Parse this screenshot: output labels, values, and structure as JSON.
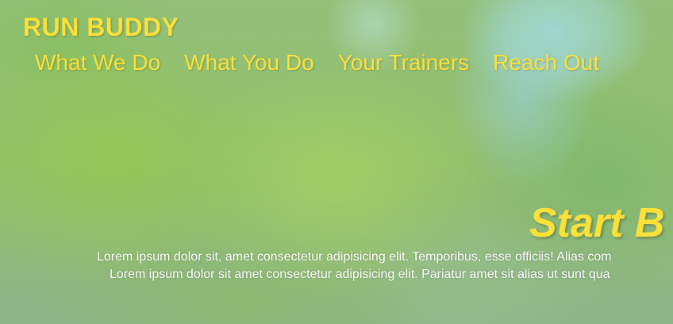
{
  "header": {
    "logo": "RUN BUDDY",
    "nav": [
      {
        "label": "What We Do"
      },
      {
        "label": "What You Do"
      },
      {
        "label": "Your Trainers"
      },
      {
        "label": "Reach Out"
      }
    ]
  },
  "hero": {
    "title": "Start B",
    "lines": [
      "Lorem ipsum dolor sit, amet consectetur adipisicing elit. Temporibus, esse officiis! Alias com",
      "Lorem ipsum dolor sit amet consectetur adipisicing elit. Pariatur amet sit alias ut sunt qua"
    ]
  },
  "colors": {
    "accent": "#fce138",
    "text_light": "#ffffff"
  }
}
